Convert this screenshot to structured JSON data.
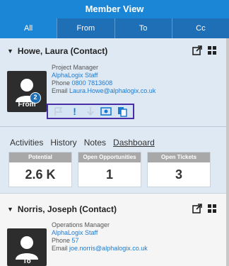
{
  "app": {
    "title": "Member View"
  },
  "tabs": [
    {
      "label": "All"
    },
    {
      "label": "From"
    },
    {
      "label": "To"
    },
    {
      "label": "Cc"
    }
  ],
  "contacts": [
    {
      "name": "Howe, Laura (Contact)",
      "role": "Project Manager",
      "company": "AlphaLogix Staff",
      "phone_label": "Phone",
      "phone": "0800 7813608",
      "email_label": "Email",
      "email": "Laura.Howe@alphalogix.co.uk",
      "avatar_label": "From",
      "badge_count": "2",
      "actions": [
        {
          "icon": "flag-icon",
          "state": "disabled"
        },
        {
          "icon": "exclamation-icon",
          "state": "active",
          "glyph": "!"
        },
        {
          "icon": "priority-low-icon",
          "state": "disabled"
        },
        {
          "icon": "money-icon",
          "state": "active"
        },
        {
          "icon": "copy-document-icon",
          "state": "active"
        }
      ],
      "subtabs": [
        {
          "label": "Activities"
        },
        {
          "label": "History"
        },
        {
          "label": "Notes"
        },
        {
          "label": "Dashboard",
          "active": true
        }
      ],
      "kpis": [
        {
          "title": "Potential",
          "value": "2.6 K"
        },
        {
          "title": "Open Opportunities",
          "value": "1"
        },
        {
          "title": "Open Tickets",
          "value": "3"
        }
      ]
    },
    {
      "name": "Norris, Joseph (Contact)",
      "role": "Operations Manager",
      "company": "AlphaLogix Staff",
      "phone_label": "Phone",
      "phone": "57",
      "email_label": "Email",
      "email": "joe.norris@alphalogix.co.uk",
      "avatar_label": "To"
    }
  ],
  "colors": {
    "accent": "#1b86d6",
    "tabbar": "#1e6fb5",
    "card_bg": "#dfe9f3",
    "highlight_border": "#4a2fa6"
  }
}
